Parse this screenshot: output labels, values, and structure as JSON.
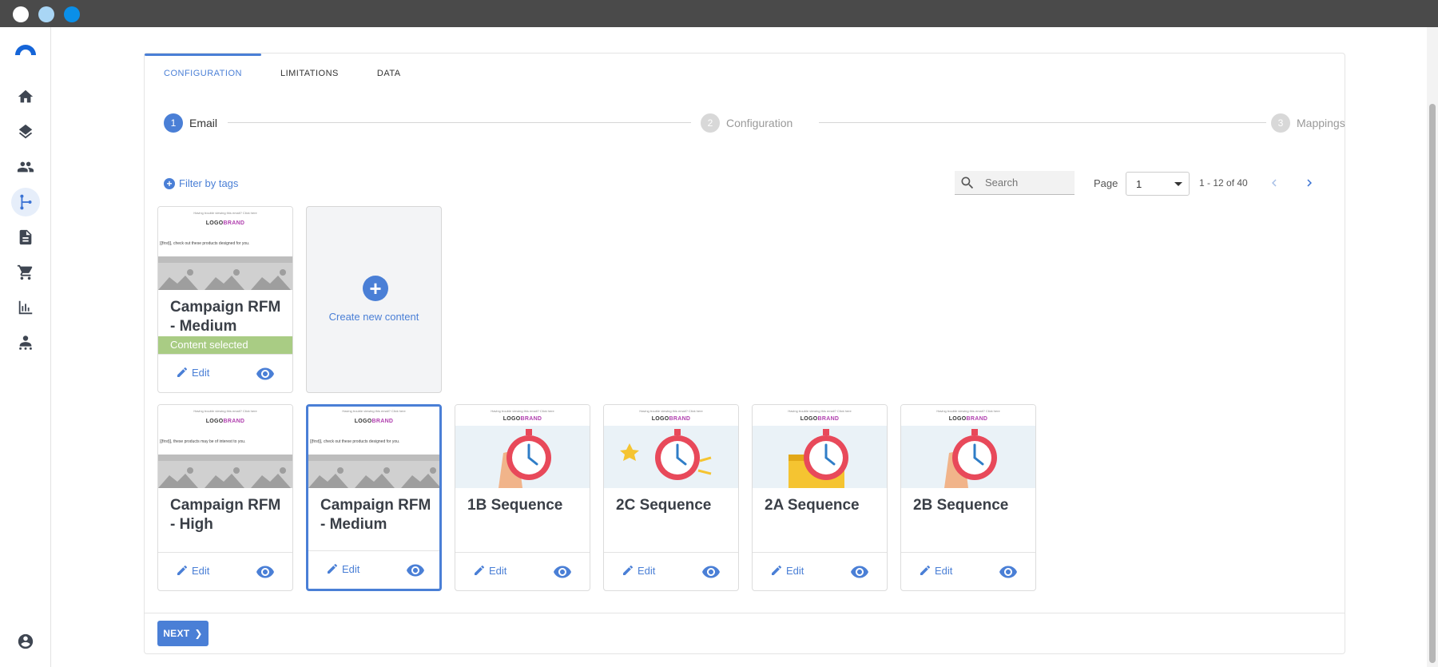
{
  "window": {
    "controls": [
      "close",
      "minimize",
      "maximize"
    ]
  },
  "sidebar": {
    "items": [
      {
        "icon": "home-icon"
      },
      {
        "icon": "layers-icon"
      },
      {
        "icon": "people-icon"
      },
      {
        "icon": "journey-icon",
        "active": true
      },
      {
        "icon": "document-icon"
      },
      {
        "icon": "cart-icon"
      },
      {
        "icon": "bar-chart-icon"
      },
      {
        "icon": "audience-icon"
      }
    ],
    "bottom_icon": "account-icon"
  },
  "tabs": [
    {
      "label": "CONFIGURATION",
      "active": true
    },
    {
      "label": "LIMITATIONS",
      "active": false
    },
    {
      "label": "DATA",
      "active": false
    }
  ],
  "stepper": [
    {
      "number": "1",
      "label": "Email",
      "active": true
    },
    {
      "number": "2",
      "label": "Configuration",
      "active": false
    },
    {
      "number": "3",
      "label": "Mappings",
      "active": false
    }
  ],
  "filter": {
    "label": "Filter by tags"
  },
  "search": {
    "placeholder": "Search"
  },
  "pagination": {
    "page_label": "Page",
    "page_value": "1",
    "range": "1 - 12 of 40"
  },
  "create": {
    "label": "Create new content"
  },
  "selected_card": {
    "title": "Campaign RFM - Medium",
    "status": "Content selected",
    "edit_label": "Edit",
    "thumb": {
      "mini": "Having trouble viewing this email? Click here",
      "logo_a": "LOGO",
      "logo_b": "BRAND",
      "text": "[{first}], check out these products designed for you."
    }
  },
  "cards": [
    {
      "title": "Campaign RFM - High",
      "edit_label": "Edit",
      "thumb_type": "products",
      "thumb_text": "[{first}], these products may be of interest to you."
    },
    {
      "title": "Campaign RFM - Medium",
      "edit_label": "Edit",
      "thumb_type": "products",
      "thumb_text": "[{first}], check out these products designed for you.",
      "highlighted": true
    },
    {
      "title": "1B Sequence",
      "edit_label": "Edit",
      "thumb_type": "clock-hand"
    },
    {
      "title": "2C Sequence",
      "edit_label": "Edit",
      "thumb_type": "clock-burst"
    },
    {
      "title": "2A Sequence",
      "edit_label": "Edit",
      "thumb_type": "clock-box"
    },
    {
      "title": "2B Sequence",
      "edit_label": "Edit",
      "thumb_type": "clock-hand"
    }
  ],
  "thumb_common": {
    "mini": "Having trouble viewing this email? Click here",
    "logo_a": "LOGO",
    "logo_b": "BRAND"
  },
  "next_button": {
    "label": "NEXT"
  },
  "colors": {
    "accent": "#4a7fd6",
    "selected": "#a9cc84",
    "titlebar": "#4a4a4a"
  }
}
